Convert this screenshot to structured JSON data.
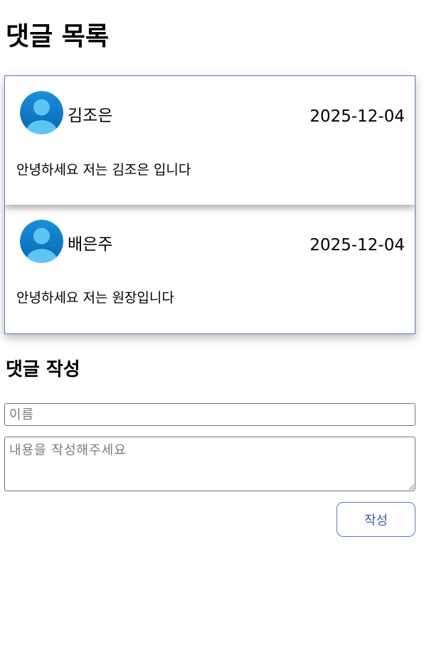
{
  "comment_list": {
    "title": "댓글 목록",
    "comments": [
      {
        "author": "김조은",
        "date": "2025-12-04",
        "content": "안녕하세요 저는 김조은 입니다",
        "avatar_icon": "user-avatar-icon"
      },
      {
        "author": "배은주",
        "date": "2025-12-04",
        "content": "안녕하세요 저는 원장입니다",
        "avatar_icon": "user-avatar-icon"
      }
    ]
  },
  "comment_form": {
    "title": "댓글 작성",
    "name_value": "",
    "name_placeholder": "이름",
    "content_value": "",
    "content_placeholder": "내용을 작성해주세요",
    "submit_label": "작성"
  },
  "colors": {
    "accent": "#5b78c4",
    "button_text": "#3d5ca8",
    "avatar_bg": "#0d7ac7",
    "avatar_figure": "#5ec4f4"
  }
}
